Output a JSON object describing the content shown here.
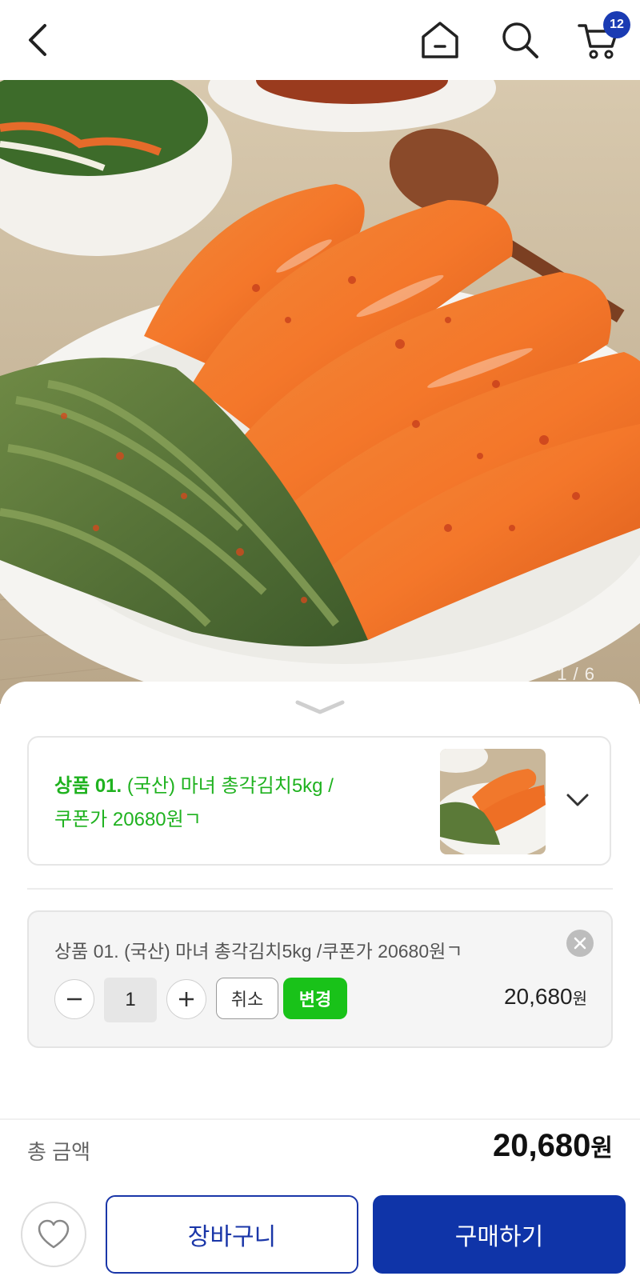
{
  "header": {
    "cart_count": "12",
    "icons": [
      "back-arrow-icon",
      "home-icon",
      "search-icon",
      "cart-icon"
    ]
  },
  "gallery": {
    "counter": "1 / 6"
  },
  "option_select": {
    "prefix": "상품 01.",
    "name_line1": " (국산) 마녀 총각김치5kg /",
    "name_line2": "쿠폰가 20680원ㄱ"
  },
  "selected_item": {
    "name": "상품 01. (국산) 마녀 총각김치5kg /쿠폰가 20680원ㄱ",
    "quantity": "1",
    "cancel_label": "취소",
    "change_label": "변경",
    "price": "20,680",
    "currency": "원"
  },
  "total": {
    "label": "총 금액",
    "amount": "20,680",
    "currency": "원"
  },
  "actions": {
    "cart_label": "장바구니",
    "buy_label": "구매하기"
  },
  "colors": {
    "brand_blue": "#0f34a8",
    "accent_green": "#19c219",
    "option_green": "#1fb21f"
  }
}
